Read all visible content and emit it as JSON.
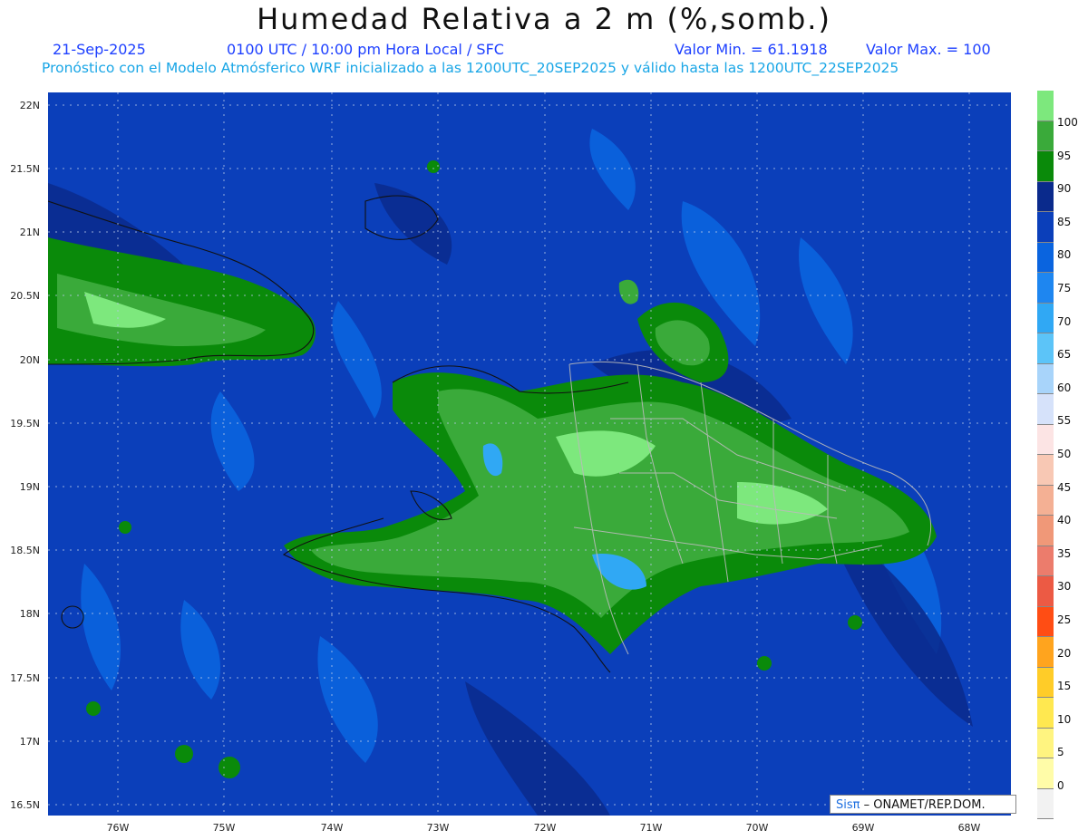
{
  "header": {
    "title": "Humedad Relativa a 2 m (%,somb.)",
    "date": "21-Sep-2025",
    "time": "0100 UTC / 10:00 pm Hora Local / SFC",
    "min_label": "Valor Min. = 61.1918",
    "max_label": "Valor Max. = 100",
    "model_info": "Pronóstico con el Modelo Atmósferico WRF inicializado a las 1200UTC_20SEP2025 y válido hasta las  1200UTC_22SEP2025"
  },
  "map": {
    "lat_labels": [
      "22N",
      "21.5N",
      "21N",
      "20.5N",
      "20N",
      "19.5N",
      "19N",
      "18.5N",
      "18N",
      "17.5N",
      "17N",
      "16.5N"
    ],
    "lon_labels": [
      "76W",
      "75W",
      "74W",
      "73W",
      "72W",
      "71W",
      "70W",
      "69W",
      "68W"
    ],
    "credit_prefix": "Sisπ",
    "credit_text": " – ONAMET/REP.DOM."
  },
  "colorbar": {
    "labels": [
      "100",
      "95",
      "90",
      "85",
      "80",
      "75",
      "70",
      "65",
      "60",
      "55",
      "50",
      "45",
      "40",
      "35",
      "30",
      "25",
      "20",
      "15",
      "10",
      "5",
      "0"
    ],
    "colors": [
      "#7de87d",
      "#3aaa3a",
      "#0a8a0a",
      "#0a2a8c",
      "#0b3fba",
      "#0a64df",
      "#1e86f0",
      "#30a8f4",
      "#5cc4f8",
      "#a8d4fa",
      "#d6e2fa",
      "#fce4e4",
      "#f8c8b4",
      "#f4b094",
      "#f09878",
      "#ec7c6c",
      "#ec5a44",
      "#ff4d14",
      "#ffa41e",
      "#ffcc28",
      "#ffe850",
      "#fff480",
      "#fffca8",
      "#f2f2f2"
    ]
  }
}
